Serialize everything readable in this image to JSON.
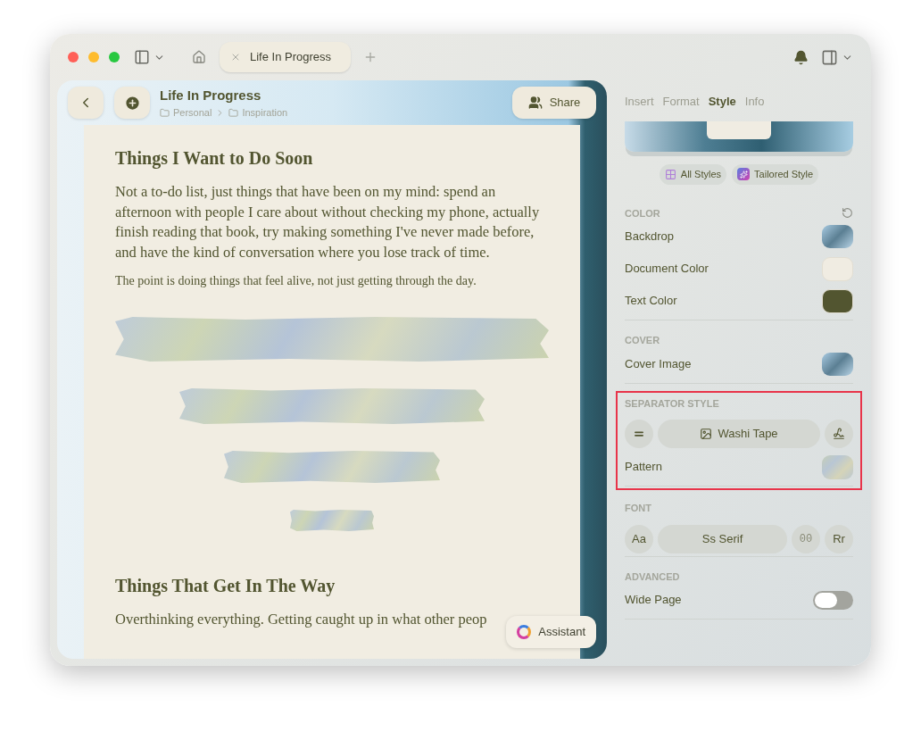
{
  "window": {
    "tabs": [
      {
        "label": "Life In Progress",
        "selected": true
      }
    ]
  },
  "document": {
    "title": "Life In Progress",
    "breadcrumb": [
      "Personal",
      "Inspiration"
    ],
    "share_label": "Share",
    "assistant_label": "Assistant",
    "blocks": [
      {
        "kind": "heading",
        "text": "Things I Want to Do Soon"
      },
      {
        "kind": "paragraph",
        "text": "Not a to-do list, just things that have been on my mind: spend an afternoon with people I care about without checking my phone, actually finish reading that book, try making something I've never made before, and have the kind of conversation where you lose track of time."
      },
      {
        "kind": "note",
        "text": "The point is doing things that feel alive, not just getting through the day."
      },
      {
        "kind": "separator"
      },
      {
        "kind": "separator"
      },
      {
        "kind": "separator"
      },
      {
        "kind": "separator"
      },
      {
        "kind": "heading",
        "text": "Things That Get In The Way"
      },
      {
        "kind": "paragraph",
        "text": "Overthinking everything. Getting caught up in what other peop"
      }
    ]
  },
  "inspector": {
    "tabs": [
      {
        "label": "Insert",
        "selected": false
      },
      {
        "label": "Format",
        "selected": false
      },
      {
        "label": "Style",
        "selected": true
      },
      {
        "label": "Info",
        "selected": false
      }
    ],
    "style_buttons": [
      "All Styles",
      "Tailored Style"
    ],
    "sections": [
      {
        "title": "COLOR",
        "highlighted": false,
        "rows": [
          {
            "kind": "photo",
            "label": "Backdrop"
          },
          {
            "kind": "color",
            "label": "Document Color",
            "color": "#f0ece2"
          },
          {
            "kind": "color",
            "label": "Text Color",
            "color": "#525530"
          }
        ]
      },
      {
        "title": "COVER",
        "highlighted": false,
        "rows": [
          {
            "kind": "photo",
            "label": "Cover Image"
          }
        ]
      },
      {
        "title": "SEPARATOR STYLE",
        "highlighted": true,
        "rows": [
          {
            "kind": "picker",
            "items": [
              "Washi Tape"
            ]
          },
          {
            "kind": "pattern",
            "label": "Pattern"
          }
        ]
      },
      {
        "title": "FONT",
        "highlighted": false,
        "rows": [
          {
            "kind": "picker",
            "items": [
              "Aa",
              "Ss Serif",
              "00",
              "Rr"
            ]
          }
        ]
      },
      {
        "title": "ADVANCED",
        "highlighted": false,
        "rows": [
          {
            "kind": "toggle",
            "label": "Wide Page",
            "on": false
          }
        ]
      }
    ]
  }
}
